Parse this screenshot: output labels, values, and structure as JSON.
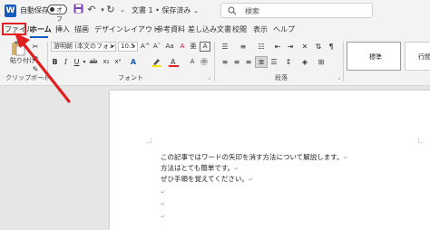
{
  "titlebar": {
    "app_logo": "W",
    "autosave_label": "自動保存",
    "autosave_state": "オフ",
    "doc_title": "文書 1 • 保存済み",
    "search_placeholder": "検索"
  },
  "tabs": [
    {
      "label": "ファイル"
    },
    {
      "label": "ホーム"
    },
    {
      "label": "挿入"
    },
    {
      "label": "描画"
    },
    {
      "label": "デザイン"
    },
    {
      "label": "レイアウト"
    },
    {
      "label": "参考資料"
    },
    {
      "label": "差し込み文書"
    },
    {
      "label": "校閲"
    },
    {
      "label": "表示"
    },
    {
      "label": "ヘルプ"
    }
  ],
  "ribbon": {
    "paste_label": "貼り付け",
    "font_name": "游明朝 (本文のフォント",
    "font_size": "10.5",
    "font_buttons": {
      "bold": "B",
      "italic": "I",
      "underline": "U",
      "strike": "ab",
      "subscript": "x₂",
      "superscript": "x²",
      "grow": "A^",
      "shrink": "Aˇ",
      "case": "Aa",
      "clear": "A",
      "phonetic": "亜",
      "charborder": "A"
    },
    "groups": {
      "clipboard": "クリップボード",
      "font": "フォント",
      "paragraph": "段落"
    },
    "styles": [
      "標準",
      "行間詰"
    ]
  },
  "document": {
    "lines": [
      "この記事ではワードの矢印を消す方法について解説します。",
      "方法はとても簡単です。",
      "ぜひ手順を覚えてください。",
      "",
      "",
      ""
    ],
    "paragraph_mark": "↵"
  },
  "colors": {
    "accent": "#185abd",
    "highlight_frame": "#e02020",
    "arrow": "#e02020"
  }
}
